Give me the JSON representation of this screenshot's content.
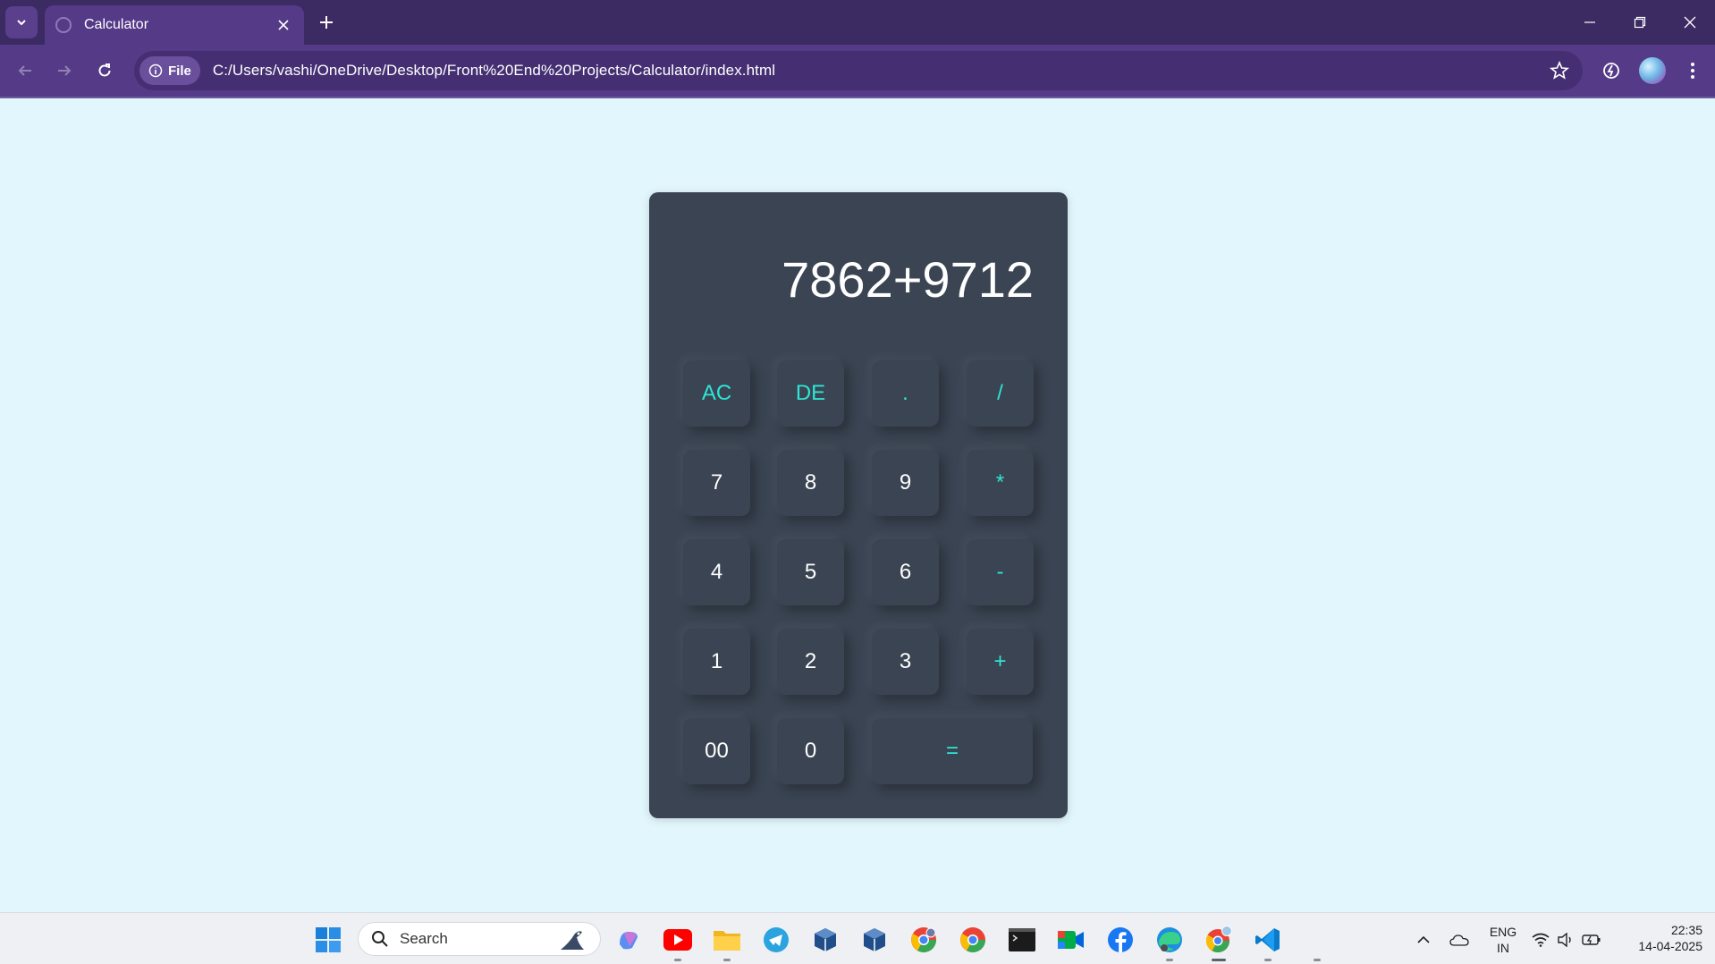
{
  "browser": {
    "tab_title": "Calculator",
    "site_chip": "File",
    "url": "C:/Users/vashi/OneDrive/Desktop/Front%20End%20Projects/Calculator/index.html"
  },
  "calculator": {
    "display": "7862+9712",
    "keys": {
      "ac": "AC",
      "de": "DE",
      "dot": ".",
      "divide": "/",
      "seven": "7",
      "eight": "8",
      "nine": "9",
      "multiply": "*",
      "four": "4",
      "five": "5",
      "six": "6",
      "minus": "-",
      "one": "1",
      "two": "2",
      "three": "3",
      "plus": "+",
      "double_zero": "00",
      "zero": "0",
      "equals": "="
    },
    "colors": {
      "panel": "#3a4452",
      "operator": "#2ee6d4",
      "digit": "#ffffff",
      "page_bg": "#e2f6fd"
    }
  },
  "taskbar": {
    "search_placeholder": "Search",
    "language": "ENG",
    "region": "IN",
    "time": "22:35",
    "date": "14-04-2025"
  }
}
